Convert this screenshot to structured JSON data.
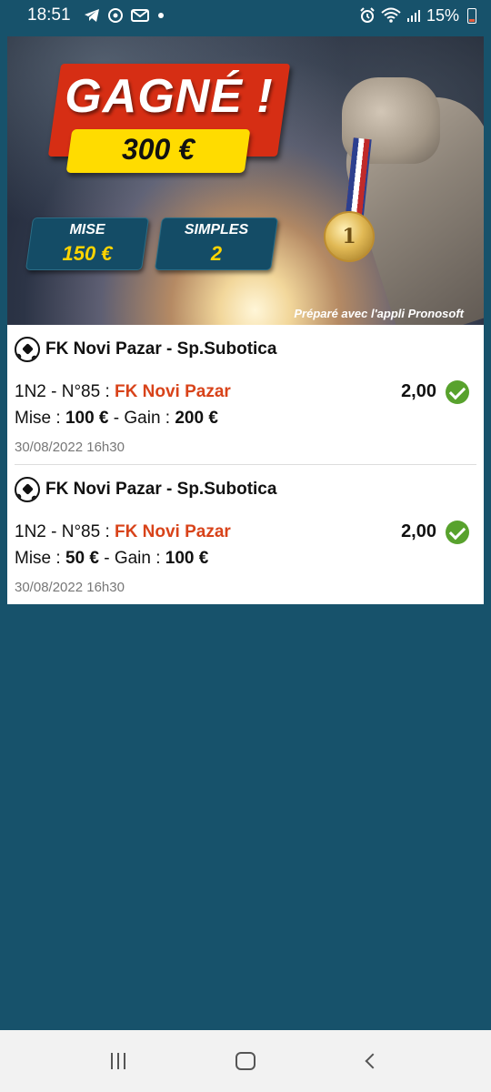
{
  "status_bar": {
    "time": "18:51",
    "battery": "15%",
    "icons": [
      "telegram-icon",
      "sync-icon",
      "email-icon",
      "dot-icon",
      "alarm-icon",
      "wifi-icon",
      "signal-icon",
      "battery-icon"
    ]
  },
  "banner": {
    "headline": "GAGNÉ !",
    "amount": "300 €",
    "stats": [
      {
        "label": "MISE",
        "value": "150 €"
      },
      {
        "label": "SIMPLES",
        "value": "2"
      }
    ],
    "credit": "Préparé avec l'appli Pronosoft",
    "medal_text": "1"
  },
  "bets": [
    {
      "match": "FK Novi Pazar - Sp.Subotica",
      "market": "1N2 - N°85 : ",
      "pick": "FK Novi Pazar",
      "odds": "2,00",
      "stake_label": "Mise : ",
      "stake": "100 €",
      "gain_label": " - Gain : ",
      "gain": "200 €",
      "date": "30/08/2022 16h30"
    },
    {
      "match": "FK Novi Pazar - Sp.Subotica",
      "market": "1N2 - N°85 : ",
      "pick": "FK Novi Pazar",
      "odds": "2,00",
      "stake_label": "Mise : ",
      "stake": "50 €",
      "gain_label": " - Gain : ",
      "gain": "100 €",
      "date": "30/08/2022 16h30"
    }
  ],
  "colors": {
    "background": "#17526b",
    "headline_red": "#d62e14",
    "amount_yellow": "#ffdc00",
    "pick_orange": "#d8431a",
    "check_green": "#58a22d"
  }
}
